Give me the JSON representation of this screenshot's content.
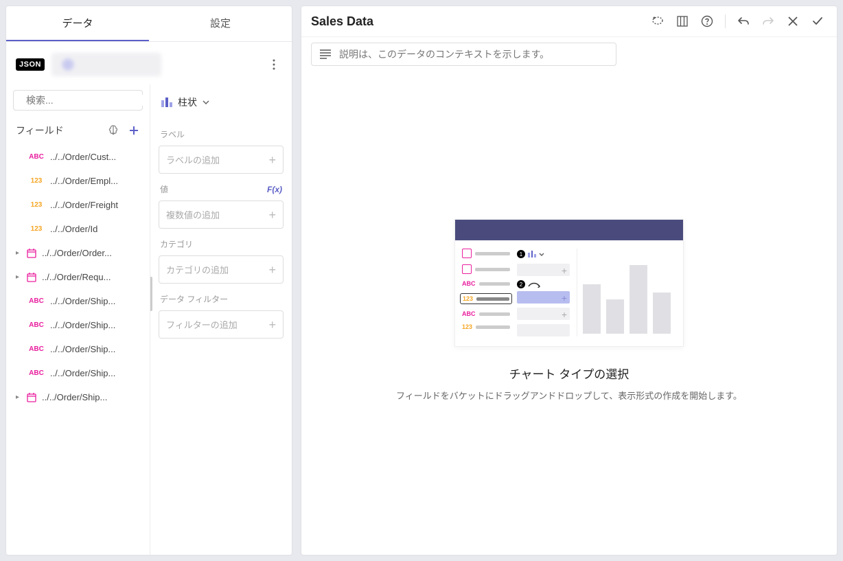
{
  "tabs": {
    "data": "データ",
    "settings": "設定"
  },
  "badge": "JSON",
  "search": {
    "placeholder": "検索..."
  },
  "fieldsHeader": "フィールド",
  "fields": [
    {
      "type": "abc",
      "label": "../../Order/Cust...",
      "expandable": false
    },
    {
      "type": "123",
      "label": "../../Order/Empl...",
      "expandable": false
    },
    {
      "type": "123",
      "label": "../../Order/Freight",
      "expandable": false
    },
    {
      "type": "123",
      "label": "../../Order/Id",
      "expandable": false
    },
    {
      "type": "date",
      "label": "../../Order/Order...",
      "expandable": true
    },
    {
      "type": "date",
      "label": "../../Order/Requ...",
      "expandable": true
    },
    {
      "type": "abc",
      "label": "../../Order/Ship...",
      "expandable": false
    },
    {
      "type": "abc",
      "label": "../../Order/Ship...",
      "expandable": false
    },
    {
      "type": "abc",
      "label": "../../Order/Ship...",
      "expandable": false
    },
    {
      "type": "abc",
      "label": "../../Order/Ship...",
      "expandable": false
    },
    {
      "type": "date",
      "label": "../../Order/Ship...",
      "expandable": true
    }
  ],
  "chartType": "柱状",
  "sections": {
    "label": {
      "title": "ラベル",
      "placeholder": "ラベルの追加"
    },
    "value": {
      "title": "値",
      "fx": "F(x)",
      "placeholder": "複数値の追加"
    },
    "category": {
      "title": "カテゴリ",
      "placeholder": "カテゴリの追加"
    },
    "filter": {
      "title": "データ フィルター",
      "placeholder": "フィルターの追加"
    }
  },
  "right": {
    "title": "Sales Data",
    "descPlaceholder": "説明は、このデータのコンテキストを示します。",
    "emptyTitle": "チャート タイプの選択",
    "emptySub": "フィールドをバケットにドラッグアンドドロップして、表示形式の作成を開始します。"
  }
}
